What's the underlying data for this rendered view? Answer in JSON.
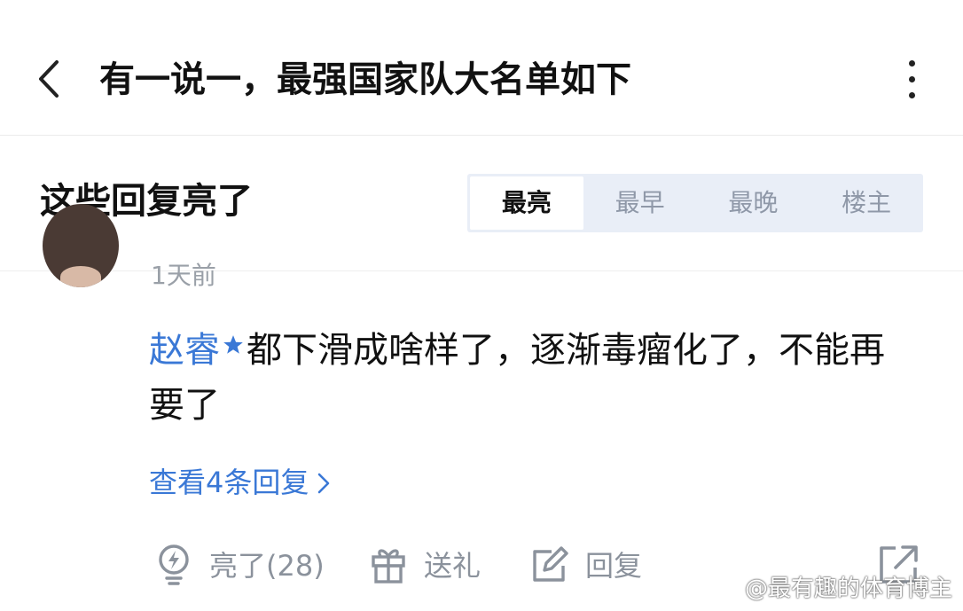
{
  "header": {
    "title": "有一说一，最强国家队大名单如下"
  },
  "section": {
    "title": "这些回复亮了",
    "sort_tabs": [
      {
        "label": "最亮",
        "active": true
      },
      {
        "label": "最早",
        "active": false
      },
      {
        "label": "最晚",
        "active": false
      },
      {
        "label": "楼主",
        "active": false
      }
    ]
  },
  "comment": {
    "time_partial": "1天前",
    "mention": "赵睿",
    "text": "都下滑成啥样了，逐渐毒瘤化了，不能再要了",
    "view_replies": "查看4条回复"
  },
  "actions": {
    "like": "亮了(28)",
    "gift": "送礼",
    "reply": "回复"
  },
  "watermark": "@最有趣的体育博主",
  "colors": {
    "link": "#3a78d6",
    "muted": "#8b929c",
    "tab_bg": "#e9eef7"
  }
}
